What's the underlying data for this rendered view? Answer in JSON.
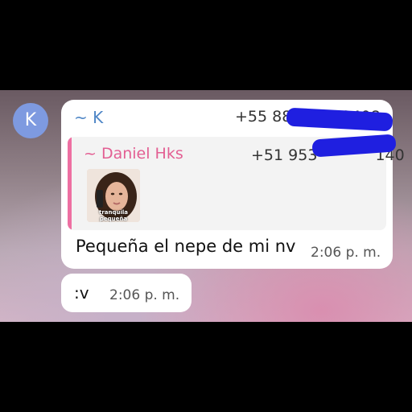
{
  "avatar": {
    "initial": "K",
    "color": "#7e9ae0"
  },
  "message1": {
    "sender": "~ K",
    "sender_phone": "+55 88",
    "sender_phone_tail": "2408",
    "quoted": {
      "sender": "~ Daniel Hks",
      "phone": "+51 953",
      "phone_tail": "140",
      "sticker_caption": "tranquila pequeña",
      "accent_color": "#ee6fa2"
    },
    "text": "Pequeña el nepe de mi nv",
    "time": "2:06 p. m."
  },
  "message2": {
    "text": ":v",
    "time": "2:06 p. m."
  },
  "colors": {
    "sender_name": "#4f86c6",
    "redaction": "#1f1fe0"
  }
}
